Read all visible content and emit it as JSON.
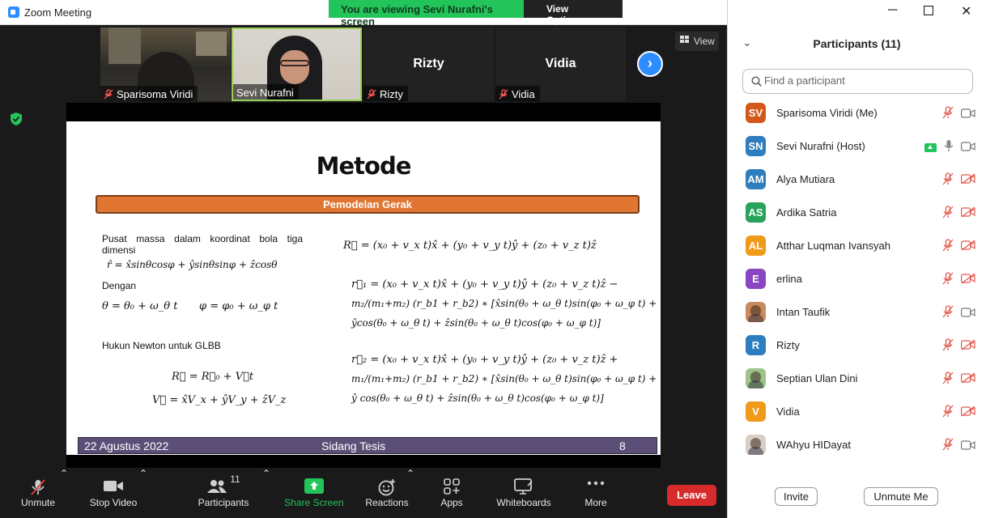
{
  "window": {
    "title": "Zoom Meeting",
    "share_banner": "You are viewing Sevi Nurafni's screen",
    "view_options": "View Options"
  },
  "video_strip": {
    "thumbnails": [
      {
        "name": "Sparisoma Viridi",
        "video": true
      },
      {
        "name": "Sevi Nurafni",
        "video": true,
        "active": true
      },
      {
        "name": "Rizty",
        "video": false
      },
      {
        "name": "Vidia",
        "video": false
      }
    ],
    "view_label": "View"
  },
  "slide": {
    "title": "Metode",
    "section": "Pemodelan Gerak",
    "intro_text": "Pusat massa dalam koordinat bola tiga dimensi",
    "rhat_eq": "r̂ = x̂sinθcosφ + ŷsinθsinφ + ẑcosθ",
    "dengan": "Dengan",
    "theta_eq": "θ = θ₀ + ω_θ t",
    "phi_eq": "φ = φ₀ + ω_φ t",
    "newton_text": "Hukun Newton untuk GLBB",
    "R_eq": "R⃗ = R⃗₀ + V⃗t",
    "V_eq": "V⃗ = x̂V_x + ŷV_y + ẑV_z",
    "R_full_eq": "R⃗ = (x₀ + v_x t)x̂ + (y₀ + v_y t)ŷ + (z₀ + v_z t)ẑ",
    "r1_line1": "r⃗₁ = (x₀ + v_x t)x̂ + (y₀ + v_y t)ŷ + (z₀ + v_z t)ẑ −",
    "r1_line2": "m₂/(m₁+m₂) (r_b1 + r_b2) ∗ [x̂sin(θ₀ + ω_θ t)sin(φ₀ + ω_φ t) +",
    "r1_line3": "ŷcos(θ₀ + ω_θ t) + ẑsin(θ₀ + ω_θ t)cos(φ₀ + ω_φ t)]",
    "r2_line1": "r⃗₂ = (x₀ + v_x t)x̂ + (y₀ + v_y t)ŷ + (z₀ + v_z t)ẑ +",
    "r2_line2": "m₁/(m₁+m₂) (r_b1 + r_b2) ∗ [x̂sin(θ₀ + ω_θ t)sin(φ₀ + ω_φ t) +",
    "r2_line3": "ŷ cos(θ₀ + ω_θ t) + ẑsin(θ₀ + ω_θ t)cos(φ₀ + ω_φ t)]",
    "footer_date": "22 Agustus 2022",
    "footer_center": "Sidang Tesis",
    "footer_page": "8"
  },
  "toolbar": {
    "unmute": "Unmute",
    "stop_video": "Stop Video",
    "participants": "Participants",
    "participant_count": "11",
    "share_screen": "Share Screen",
    "reactions": "Reactions",
    "apps": "Apps",
    "whiteboards": "Whiteboards",
    "more": "More",
    "leave": "Leave"
  },
  "participants_panel": {
    "header": "Participants (11)",
    "search_placeholder": "Find a participant",
    "invite": "Invite",
    "unmute_me": "Unmute Me",
    "participants": [
      {
        "initials": "SV",
        "name": "Sparisoma Viridi (Me)",
        "color": "#d4581c",
        "mic": "muted",
        "video": "on"
      },
      {
        "initials": "SN",
        "name": "Sevi Nurafni (Host)",
        "color": "#2e7dbf",
        "mic": "on",
        "video": "on",
        "sharing": true
      },
      {
        "initials": "AM",
        "name": "Alya Mutiara",
        "color": "#2e7dbf",
        "mic": "muted",
        "video": "off"
      },
      {
        "initials": "AS",
        "name": "Ardika Satria",
        "color": "#27a35a",
        "mic": "muted",
        "video": "off"
      },
      {
        "initials": "AL",
        "name": "Atthar Luqman Ivansyah",
        "color": "#f09a1a",
        "mic": "muted",
        "video": "off"
      },
      {
        "initials": "E",
        "name": "erlina",
        "color": "#8a45c2",
        "mic": "muted",
        "video": "off"
      },
      {
        "initials": "",
        "name": "Intan Taufik",
        "color": "#c98a5c",
        "photo": true,
        "mic": "muted",
        "video": "on"
      },
      {
        "initials": "R",
        "name": "Rizty",
        "color": "#2e7dbf",
        "mic": "muted",
        "video": "off"
      },
      {
        "initials": "",
        "name": "Septian Ulan Dini",
        "color": "#9dc48a",
        "photo": true,
        "mic": "muted",
        "video": "off"
      },
      {
        "initials": "V",
        "name": "Vidia",
        "color": "#f09a1a",
        "mic": "muted",
        "video": "off"
      },
      {
        "initials": "",
        "name": "WAhyu HIDayat",
        "color": "#d8cfc4",
        "photo": true,
        "mic": "muted",
        "video": "on"
      }
    ]
  }
}
